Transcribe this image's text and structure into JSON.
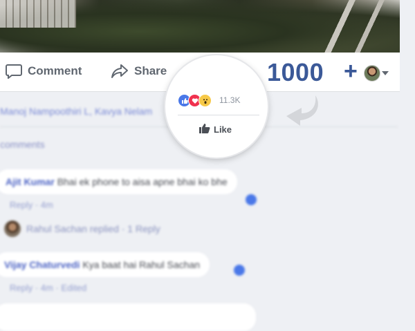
{
  "actions": {
    "comment_label": "Comment",
    "share_label": "Share"
  },
  "overlay": {
    "count": "1000",
    "plus": "+"
  },
  "magnifier": {
    "reactions": [
      "like",
      "love",
      "wow"
    ],
    "reaction_count": "11.3K",
    "like_label": "Like"
  },
  "colors": {
    "facebook_blue": "#3b5998",
    "like_blue": "#4a78e8",
    "love_red": "#f0314e",
    "wow_yellow": "#f7c948",
    "background": "#eef0f4"
  },
  "comments": {
    "likers_text": "Manoj Nampoothiri L, Kavya Nelam",
    "more_comments": "comments",
    "items": [
      {
        "name": "Ajit Kumar",
        "text": "Bhai ek phone to aisa apne bhai ko bhe",
        "meta": "Reply · 4m"
      },
      {
        "name": "Vijay Chaturvedi",
        "text": "Kya baat hai Rahul Sachan",
        "meta": "Reply · 4m · Edited"
      }
    ],
    "reply_summary": "Rahul Sachan replied · 1 Reply"
  }
}
